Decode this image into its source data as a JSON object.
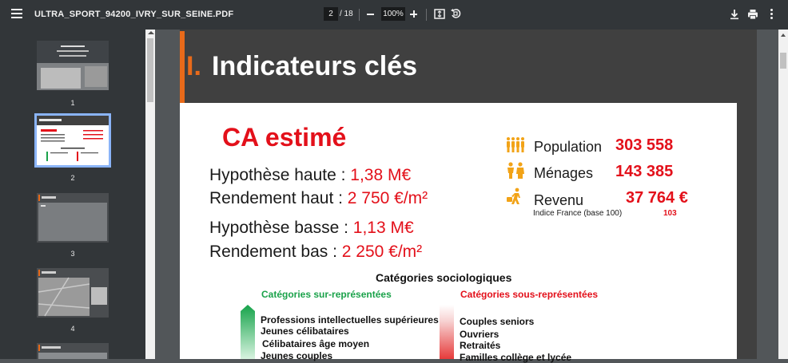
{
  "toolbar": {
    "title": "ULTRA_SPORT_94200_IVRY_SUR_SEINE.PDF",
    "page_current": "2",
    "page_total": "/ 18",
    "zoom": "100%"
  },
  "sidebar": {
    "thumbnails": [
      {
        "num": "1"
      },
      {
        "num": "2"
      },
      {
        "num": "3"
      },
      {
        "num": "4"
      }
    ]
  },
  "page": {
    "title_num": "I.",
    "title_text": "Indicateurs clés",
    "ca_title": "CA estimé",
    "hyp_high_label": "Hypothèse haute : ",
    "hyp_high_value": "1,38 M€",
    "rend_high_label": "Rendement haut : ",
    "rend_high_value": "2 750 €/m²",
    "hyp_low_label": "Hypothèse basse : ",
    "hyp_low_value": "1,13 M€",
    "rend_low_label": "Rendement bas : ",
    "rend_low_value": "2 250 €/m²",
    "population_label": "Population",
    "population_value": "303 558",
    "menages_label": "Ménages",
    "menages_value": "143 385",
    "revenu_label": "Revenu",
    "revenu_value": "37 764 €",
    "indice_label": "Indice France (base 100)",
    "indice_value": "103",
    "categories_title": "Catégories sociologiques",
    "over_title": "Catégories sur-représentées",
    "under_title": "Catégories sous-représentées",
    "over_items": [
      "Professions intellectuelles supérieures",
      "Jeunes célibataires",
      "Célibataires âge moyen",
      "Jeunes couples"
    ],
    "under_items": [
      "Couples seniors",
      "Ouvriers",
      "Retraités",
      "Familles collège et lycée"
    ]
  },
  "colors": {
    "accent_orange": "#e86a1a",
    "value_red": "#e3101a",
    "over_green": "#1aa24a",
    "icon_orange": "#f2a317"
  },
  "icons": [
    "menu-icon",
    "minus-icon",
    "plus-icon",
    "fit-page-icon",
    "rotate-icon",
    "download-icon",
    "print-icon",
    "more-icon",
    "population-icon",
    "households-icon",
    "income-icon"
  ]
}
